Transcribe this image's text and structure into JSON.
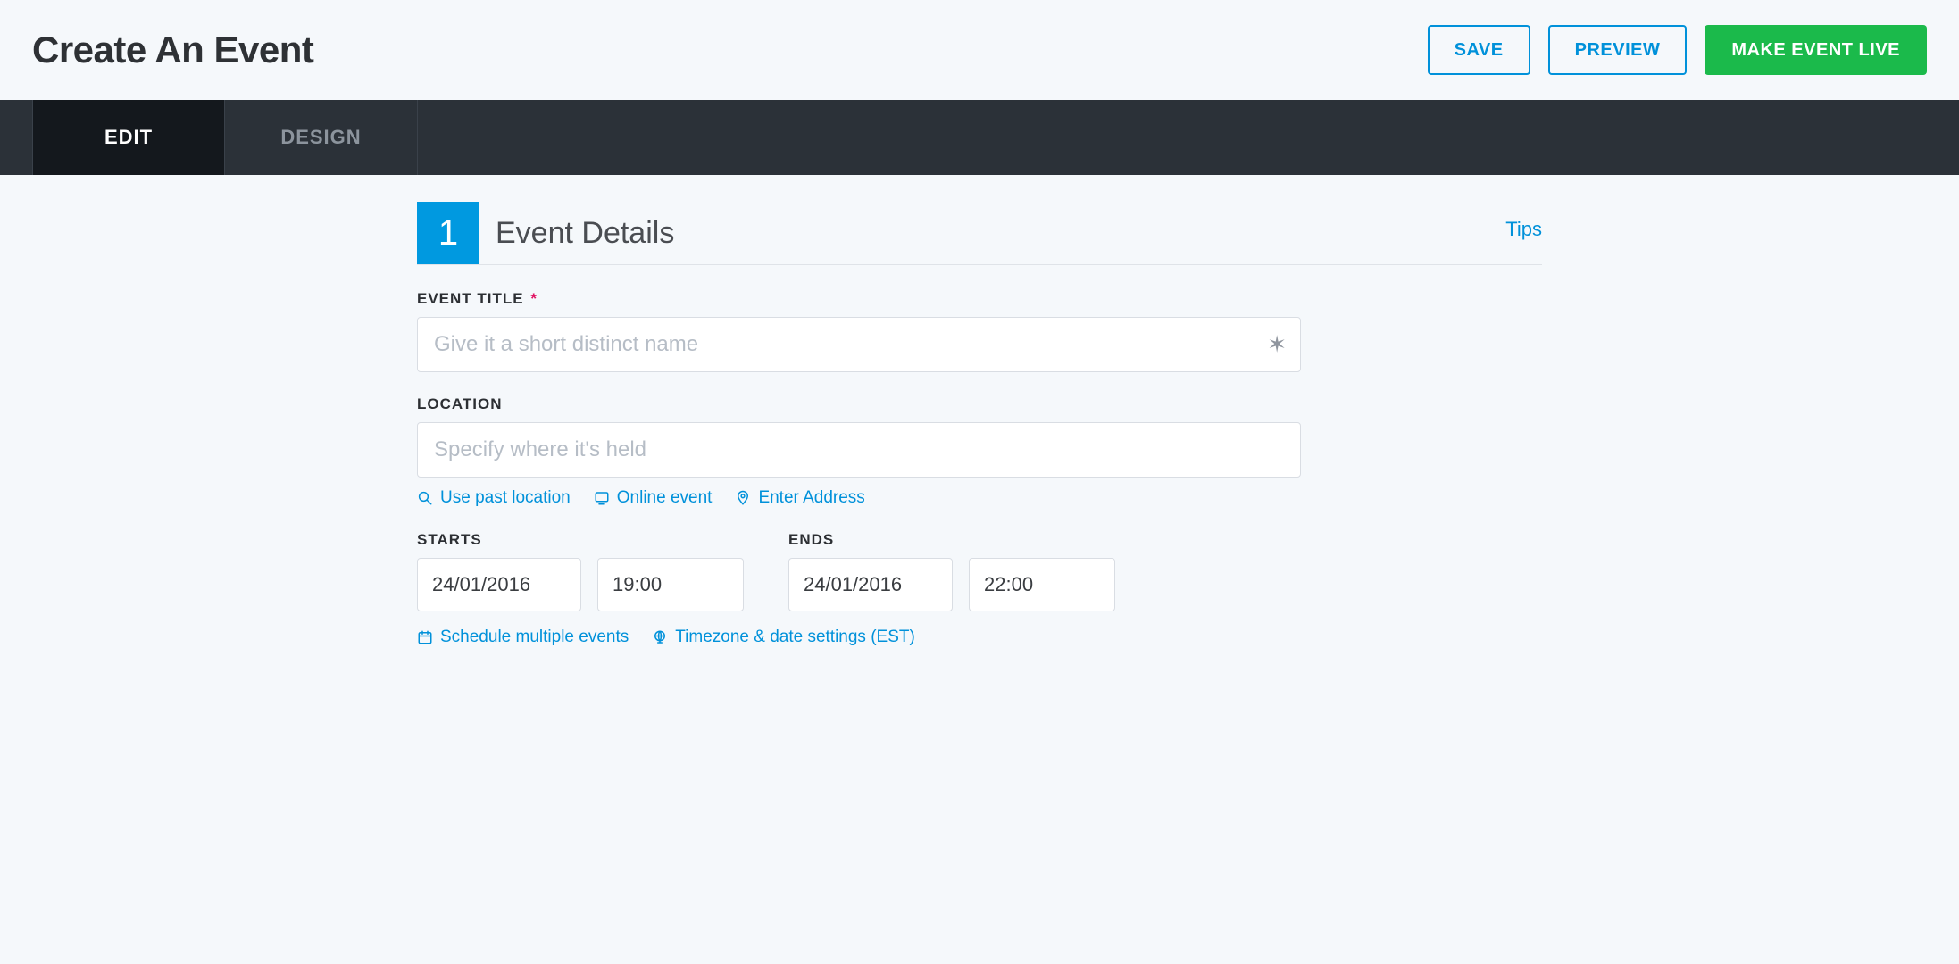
{
  "header": {
    "title": "Create An Event",
    "save": "SAVE",
    "preview": "PREVIEW",
    "make_live": "MAKE EVENT LIVE"
  },
  "tabs": {
    "edit": "EDIT",
    "design": "DESIGN"
  },
  "section": {
    "number": "1",
    "title": "Event Details",
    "tips": "Tips"
  },
  "event_title": {
    "label": "EVENT TITLE",
    "required_mark": "*",
    "placeholder": "Give it a short distinct name",
    "value": ""
  },
  "location": {
    "label": "LOCATION",
    "placeholder": "Specify where it's held",
    "value": "",
    "links": {
      "past": "Use past location",
      "online": "Online event",
      "address": "Enter Address"
    }
  },
  "starts": {
    "label": "STARTS",
    "date": "24/01/2016",
    "time": "19:00"
  },
  "ends": {
    "label": "ENDS",
    "date": "24/01/2016",
    "time": "22:00"
  },
  "bottom_links": {
    "schedule": "Schedule multiple events",
    "timezone": "Timezone & date settings (EST)"
  }
}
